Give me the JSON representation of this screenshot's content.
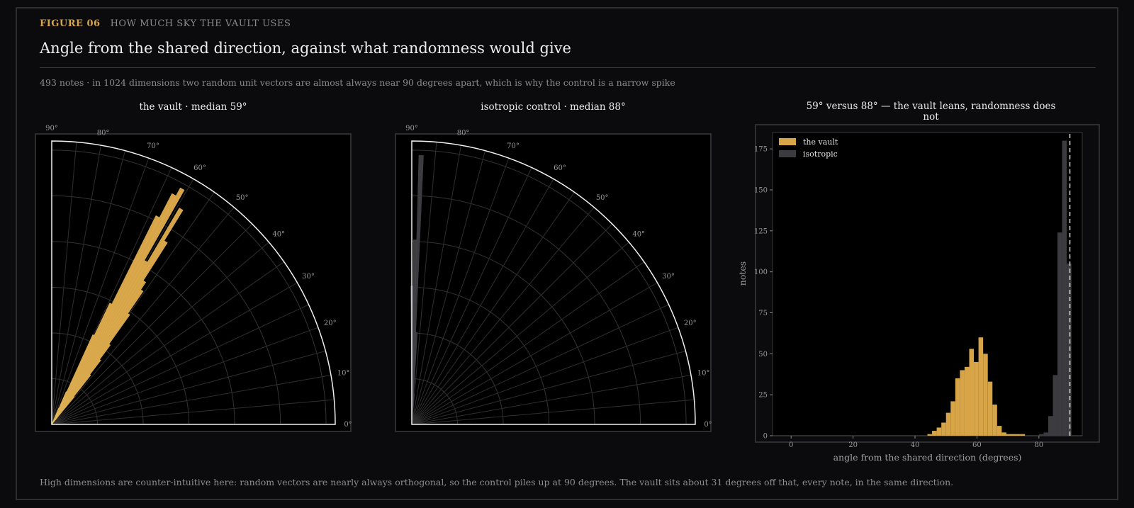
{
  "header": {
    "figure_label": "FIGURE 06",
    "caption": "HOW MUCH SKY THE VAULT USES",
    "title": "Angle from the shared direction, against what randomness would give",
    "subtitle": "493 notes  ·  in 1024 dimensions two random unit vectors are almost always near 90 degrees apart, which is why the control is a narrow spike"
  },
  "footer": "High dimensions are counter-intuitive here: random vectors are nearly always orthogonal, so the control piles up at 90 degrees. The vault sits about 31 degrees off that, every note, in the same direction.",
  "colors": {
    "vault": "#d7a548",
    "isotropic": "#3b3b40",
    "background": "#0b0b0d",
    "panel": "#000000"
  },
  "chart_data": [
    {
      "type": "polar-histogram",
      "title": "the vault  ·  median 59°",
      "theta_ticks": [
        "0°",
        "10°",
        "20°",
        "30°",
        "40°",
        "50°",
        "60°",
        "70°",
        "80°",
        "90°"
      ],
      "theta_range": [
        0,
        90
      ],
      "bins": [
        {
          "angle": 50,
          "count": 2
        },
        {
          "angle": 51,
          "count": 8
        },
        {
          "angle": 52,
          "count": 14
        },
        {
          "angle": 53,
          "count": 18
        },
        {
          "angle": 54,
          "count": 22
        },
        {
          "angle": 55,
          "count": 30
        },
        {
          "angle": 56,
          "count": 36
        },
        {
          "angle": 57,
          "count": 38
        },
        {
          "angle": 58,
          "count": 48
        },
        {
          "angle": 59,
          "count": 56
        },
        {
          "angle": 60,
          "count": 42
        },
        {
          "angle": 61,
          "count": 60
        },
        {
          "angle": 62,
          "count": 58
        },
        {
          "angle": 63,
          "count": 52
        },
        {
          "angle": 64,
          "count": 30
        },
        {
          "angle": 65,
          "count": 22
        },
        {
          "angle": 66,
          "count": 8
        },
        {
          "angle": 67,
          "count": 4
        }
      ]
    },
    {
      "type": "polar-histogram",
      "title": "isotropic control  ·  median 88°",
      "theta_ticks": [
        "0°",
        "10°",
        "20°",
        "30°",
        "40°",
        "50°",
        "60°",
        "70°",
        "80°",
        "90°"
      ],
      "theta_range": [
        0,
        90
      ],
      "bins": [
        {
          "angle": 85,
          "count": 5
        },
        {
          "angle": 86,
          "count": 20
        },
        {
          "angle": 87,
          "count": 60
        },
        {
          "angle": 88,
          "count": 175
        },
        {
          "angle": 89,
          "count": 120
        },
        {
          "angle": 90,
          "count": 90
        }
      ]
    },
    {
      "type": "bar",
      "title": "59° versus 88° — the vault leans, randomness does not",
      "xlabel": "angle from the shared direction (degrees)",
      "ylabel": "notes",
      "xlim": [
        -6,
        94
      ],
      "ylim": [
        0,
        185
      ],
      "xticks": [
        0,
        20,
        40,
        60,
        80
      ],
      "yticks": [
        0,
        25,
        50,
        75,
        100,
        125,
        150,
        175
      ],
      "bin_width": 1.5,
      "reference_line_x": 90,
      "legend": "top-left",
      "series": [
        {
          "name": "the vault",
          "bins": [
            {
              "x": 44,
              "value": 1
            },
            {
              "x": 45.5,
              "value": 3
            },
            {
              "x": 47,
              "value": 5
            },
            {
              "x": 48.5,
              "value": 8
            },
            {
              "x": 50,
              "value": 14
            },
            {
              "x": 51.5,
              "value": 21
            },
            {
              "x": 53,
              "value": 35
            },
            {
              "x": 54.5,
              "value": 40
            },
            {
              "x": 56,
              "value": 42
            },
            {
              "x": 57.5,
              "value": 53
            },
            {
              "x": 59,
              "value": 45
            },
            {
              "x": 60.5,
              "value": 60
            },
            {
              "x": 62,
              "value": 50
            },
            {
              "x": 63.5,
              "value": 33
            },
            {
              "x": 65,
              "value": 19
            },
            {
              "x": 66.5,
              "value": 6
            },
            {
              "x": 68,
              "value": 2
            },
            {
              "x": 69.5,
              "value": 1
            },
            {
              "x": 71,
              "value": 1
            },
            {
              "x": 72.5,
              "value": 1
            },
            {
              "x": 74,
              "value": 1
            }
          ]
        },
        {
          "name": "isotropic",
          "bins": [
            {
              "x": 80,
              "value": 1
            },
            {
              "x": 81.5,
              "value": 2
            },
            {
              "x": 83,
              "value": 12
            },
            {
              "x": 84.5,
              "value": 37
            },
            {
              "x": 86,
              "value": 124
            },
            {
              "x": 87.5,
              "value": 180
            },
            {
              "x": 89,
              "value": 105
            }
          ]
        }
      ]
    }
  ]
}
